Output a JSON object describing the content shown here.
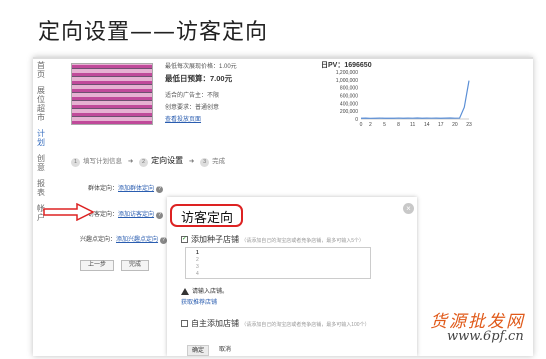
{
  "slide": {
    "title": "定向设置——访客定向"
  },
  "nav": {
    "items": [
      {
        "label": "首\n页"
      },
      {
        "label": "展\n位\n超\n市"
      },
      {
        "label": "计\n划",
        "active": true
      },
      {
        "label": "创\n意"
      },
      {
        "label": "报\n表"
      },
      {
        "label": "帐\n户"
      }
    ]
  },
  "ad_info": {
    "max_bid": "最低每次展现价格：1.00元",
    "daily_budget_label": "最低日预算：",
    "daily_budget_value": "7.00元",
    "line3": "适合的广告主：不限",
    "line4": "创意要求：普通创意",
    "link": "查看投放页面"
  },
  "chart_data": {
    "type": "line",
    "title": "日PV：1696650",
    "x": [
      0,
      1,
      2,
      3,
      4,
      5,
      6,
      7,
      8,
      9,
      10,
      11,
      12,
      13,
      14,
      15,
      16,
      17,
      18,
      19,
      20,
      21,
      22,
      23
    ],
    "xticks": [
      "0",
      "2",
      "5",
      "8",
      "11",
      "14",
      "17",
      "20",
      "23"
    ],
    "xtick_values": [
      0,
      2,
      5,
      8,
      11,
      14,
      17,
      20,
      23
    ],
    "yticks": [
      "1,200,000",
      "1,000,000",
      "800,000",
      "600,000",
      "400,000",
      "200,000",
      "0"
    ],
    "ytick_values": [
      1200000,
      1000000,
      800000,
      600000,
      400000,
      200000,
      0
    ],
    "ylim": [
      0,
      1200000
    ],
    "values": [
      20000,
      22000,
      18000,
      20000,
      23000,
      19000,
      21000,
      20000,
      24000,
      20000,
      22000,
      21000,
      25000,
      20000,
      22000,
      21000,
      23000,
      20000,
      22000,
      26000,
      21000,
      24000,
      300000,
      980000
    ],
    "color": "#5b8fd6",
    "grid": false
  },
  "steps": {
    "s1": "填写计划信息",
    "s2": "定向设置",
    "s3": "完成",
    "n1": "1",
    "n2": "2",
    "n3": "3",
    "arrow": "➜"
  },
  "form": {
    "group_label": "群体定向：",
    "group_link": "添加群体定向",
    "visitor_label": "访客定向：",
    "visitor_link": "添加访客定向",
    "interest_label": "兴趣点定向：",
    "interest_link": "添加兴趣点定向",
    "help": "?",
    "prev_btn": "上一步",
    "finish_btn": "完成"
  },
  "modal": {
    "title": "访客定向",
    "close": "×",
    "seed_label": "添加种子店铺",
    "seed_hint": "（请添加自己的淘宝店或者竞争店铺，最多可输入5个）",
    "seed_checked": true,
    "lines": [
      "1",
      "2",
      "3",
      "4"
    ],
    "warn": "请输入店铺。",
    "get_rec": "获取推荐店铺",
    "self_label": "自主添加店铺",
    "self_hint": "（请添加自己的淘宝店或者竞争店铺，最多可输入100个）",
    "ok": "确定",
    "cancel": "取消"
  },
  "watermark": {
    "line1": "货源批发网",
    "line2": "www.6pf.cn"
  },
  "colors": {
    "accent": "#2a5db0",
    "highlight": "#d22222",
    "chart_line": "#5b8fd6"
  }
}
